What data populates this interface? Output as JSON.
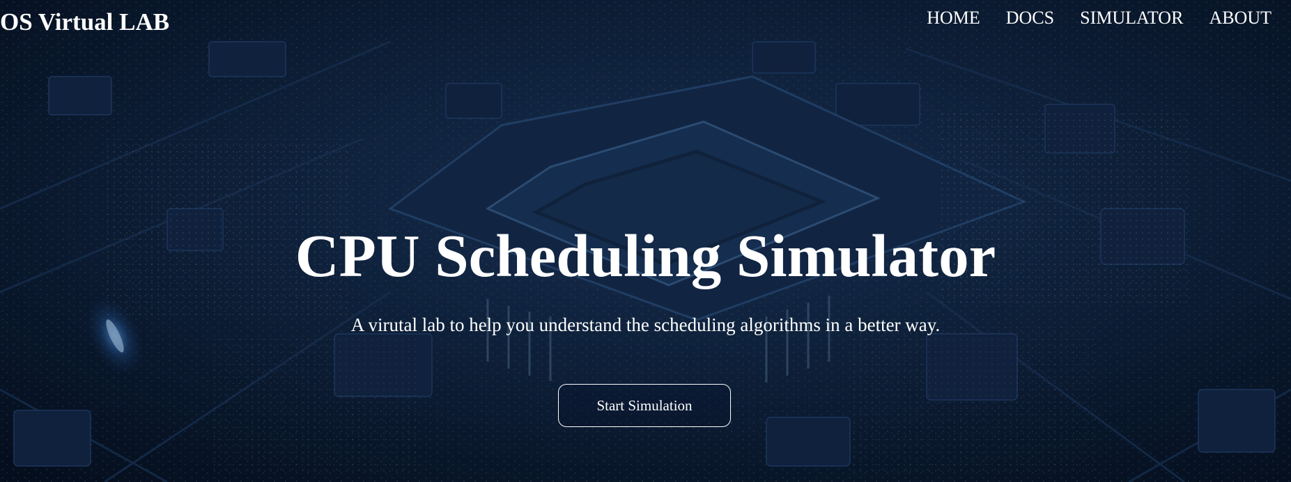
{
  "header": {
    "brand": "OS Virtual LAB",
    "nav": [
      {
        "label": "HOME"
      },
      {
        "label": "DOCS"
      },
      {
        "label": "SIMULATOR"
      },
      {
        "label": "ABOUT"
      }
    ]
  },
  "hero": {
    "title": "CPU Scheduling Simulator",
    "subtitle": "A virutal lab to help you understand the scheduling algorithms in a better way.",
    "cta_label": "Start Simulation"
  },
  "colors": {
    "background": "#0a1628",
    "text": "#ffffff",
    "chip": "#1b3357",
    "pcb_line": "#1e3a60"
  },
  "background_image": "circuit-board-cpu-chip"
}
